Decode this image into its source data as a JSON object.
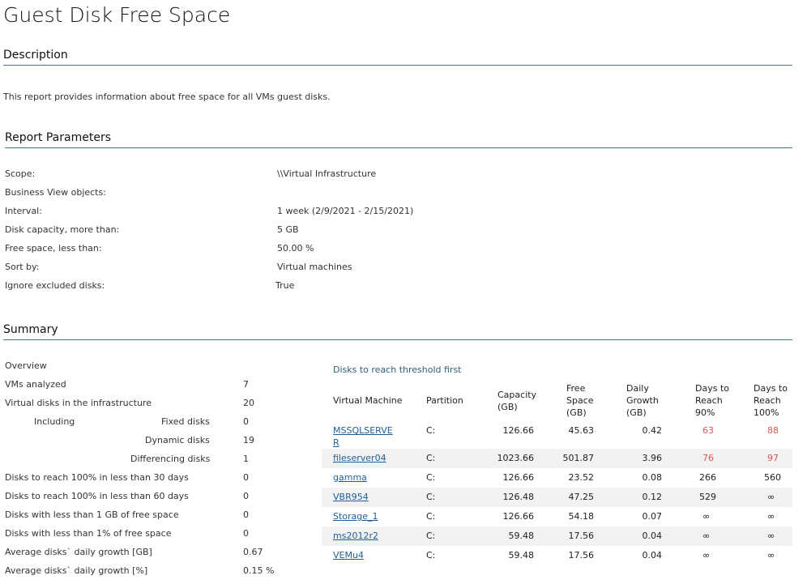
{
  "title": "Guest Disk Free Space",
  "description": {
    "header": "Description",
    "text": "This report provides information about free space for all VMs guest disks."
  },
  "parameters": {
    "header": "Report Parameters",
    "rows": [
      {
        "label": "Scope:",
        "value": "\\\\Virtual Infrastructure"
      },
      {
        "label": "Business View objects:",
        "value": ""
      },
      {
        "label": "Interval:",
        "value": "1 week (2/9/2021 - 2/15/2021)"
      },
      {
        "label": "Disk capacity, more than:",
        "value": "5 GB"
      },
      {
        "label": "Free space, less than:",
        "value": "50.00 %"
      },
      {
        "label": "Sort by:",
        "value": "Virtual machines"
      },
      {
        "label": "Ignore excluded disks:",
        "value": "True"
      }
    ]
  },
  "summary": {
    "header": "Summary",
    "overview_label": "Overview",
    "vms_analyzed": {
      "label": "VMs analyzed",
      "value": "7"
    },
    "virtual_disks": {
      "label": "Virtual disks in the infrastructure",
      "value": "20"
    },
    "including_label": "Including",
    "fixed": {
      "label": "Fixed disks",
      "value": "0"
    },
    "dynamic": {
      "label": "Dynamic disks",
      "value": "19"
    },
    "differencing": {
      "label": "Differencing disks",
      "value": "1"
    },
    "rest": [
      {
        "label": "Disks to reach 100% in less than 30 days",
        "value": "0"
      },
      {
        "label": "Disks to reach 100% in less than 60 days",
        "value": "0"
      },
      {
        "label": "Disks with less than 1 GB of free space",
        "value": "0"
      },
      {
        "label": "Disks with less than 1% of free space",
        "value": "0"
      },
      {
        "label": "Average disks` daily growth [GB]",
        "value": "0.67"
      },
      {
        "label": "Average disks` daily growth [%]",
        "value": "0.15 %"
      }
    ]
  },
  "disks_table": {
    "caption": "Disks to reach threshold first",
    "headers": {
      "vm": "Virtual Machine",
      "partition": "Partition",
      "capacity_1": "Capacity",
      "capacity_2": "(GB)",
      "free_1": "Free",
      "free_2": "Space",
      "free_3": "(GB)",
      "growth_1": "Daily",
      "growth_2": "Growth",
      "growth_3": "(GB)",
      "d90_1": "Days to",
      "d90_2": "Reach",
      "d90_3": "90%",
      "d100_1": "Days to",
      "d100_2": "Reach",
      "d100_3": "100%"
    },
    "rows": [
      {
        "vm_1": "MSSQLSERVE",
        "vm_2": "R",
        "partition": "C:",
        "capacity": "126.66",
        "free": "45.63",
        "growth": "0.42",
        "d90": "63",
        "d100": "88"
      },
      {
        "vm_1": "fileserver04",
        "vm_2": "",
        "partition": "C:",
        "capacity": "1023.66",
        "free": "501.87",
        "growth": "3.96",
        "d90": "76",
        "d100": "97"
      },
      {
        "vm_1": "gamma",
        "vm_2": "",
        "partition": "C:",
        "capacity": "126.66",
        "free": "23.52",
        "growth": "0.08",
        "d90": "266",
        "d100": "560"
      },
      {
        "vm_1": "VBR954",
        "vm_2": "",
        "partition": "C:",
        "capacity": "126.48",
        "free": "47.25",
        "growth": "0.12",
        "d90": "529",
        "d100": "∞"
      },
      {
        "vm_1": "Storage_1",
        "vm_2": "",
        "partition": "C:",
        "capacity": "126.66",
        "free": "54.18",
        "growth": "0.07",
        "d90": "∞",
        "d100": "∞"
      },
      {
        "vm_1": "ms2012r2",
        "vm_2": "",
        "partition": "C:",
        "capacity": "59.48",
        "free": "17.56",
        "growth": "0.04",
        "d90": "∞",
        "d100": "∞"
      },
      {
        "vm_1": "VEMu4",
        "vm_2": "",
        "partition": "C:",
        "capacity": "59.48",
        "free": "17.56",
        "growth": "0.04",
        "d90": "∞",
        "d100": "∞"
      }
    ]
  }
}
